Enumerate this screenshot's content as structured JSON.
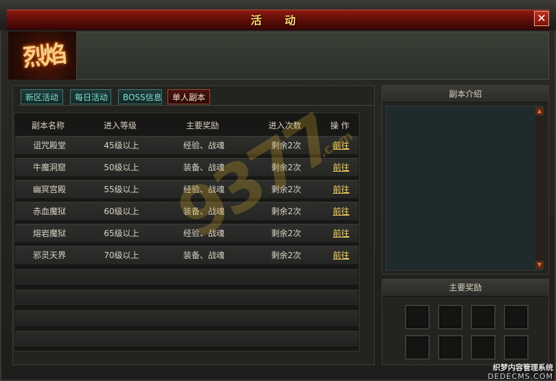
{
  "window": {
    "title": "活 动",
    "close_glyph": "✕"
  },
  "logo": {
    "text": "烈焰"
  },
  "tabs": [
    {
      "label": "新区活动",
      "active": false
    },
    {
      "label": "每日活动",
      "active": false
    },
    {
      "label": "BOSS信息",
      "active": false
    },
    {
      "label": "单人副本",
      "active": true
    }
  ],
  "table": {
    "headers": [
      "副本名称",
      "进入等级",
      "主要奖励",
      "进入次数",
      "操 作"
    ],
    "rows": [
      {
        "name": "诅咒殿堂",
        "level": "45级以上",
        "reward": "经验、战魂",
        "times": "剩余2次",
        "action": "前往"
      },
      {
        "name": "牛魔洞窟",
        "level": "50级以上",
        "reward": "装备、战魂",
        "times": "剩余2次",
        "action": "前往"
      },
      {
        "name": "幽冥宫殿",
        "level": "55级以上",
        "reward": "经验、战魂",
        "times": "剩余2次",
        "action": "前往"
      },
      {
        "name": "赤血魔狱",
        "level": "60级以上",
        "reward": "装备、战魂",
        "times": "剩余2次",
        "action": "前往"
      },
      {
        "name": "熔岩魔狱",
        "level": "65级以上",
        "reward": "经验、战魂",
        "times": "剩余2次",
        "action": "前往"
      },
      {
        "name": "邪灵天界",
        "level": "70级以上",
        "reward": "装备、战魂",
        "times": "剩余2次",
        "action": "前往"
      }
    ]
  },
  "intro_panel": {
    "title": "副本介绍"
  },
  "reward_panel": {
    "title": "主要奖励"
  },
  "watermark": {
    "text": "9377",
    "suffix": ".com"
  },
  "credit": {
    "line1": "织梦内容管理系统",
    "line2": "DEDECMS.COM"
  },
  "colors": {
    "accent_red": "#8e1a12",
    "link_gold": "#ffd75c",
    "tab_teal": "#7fe2d6"
  }
}
